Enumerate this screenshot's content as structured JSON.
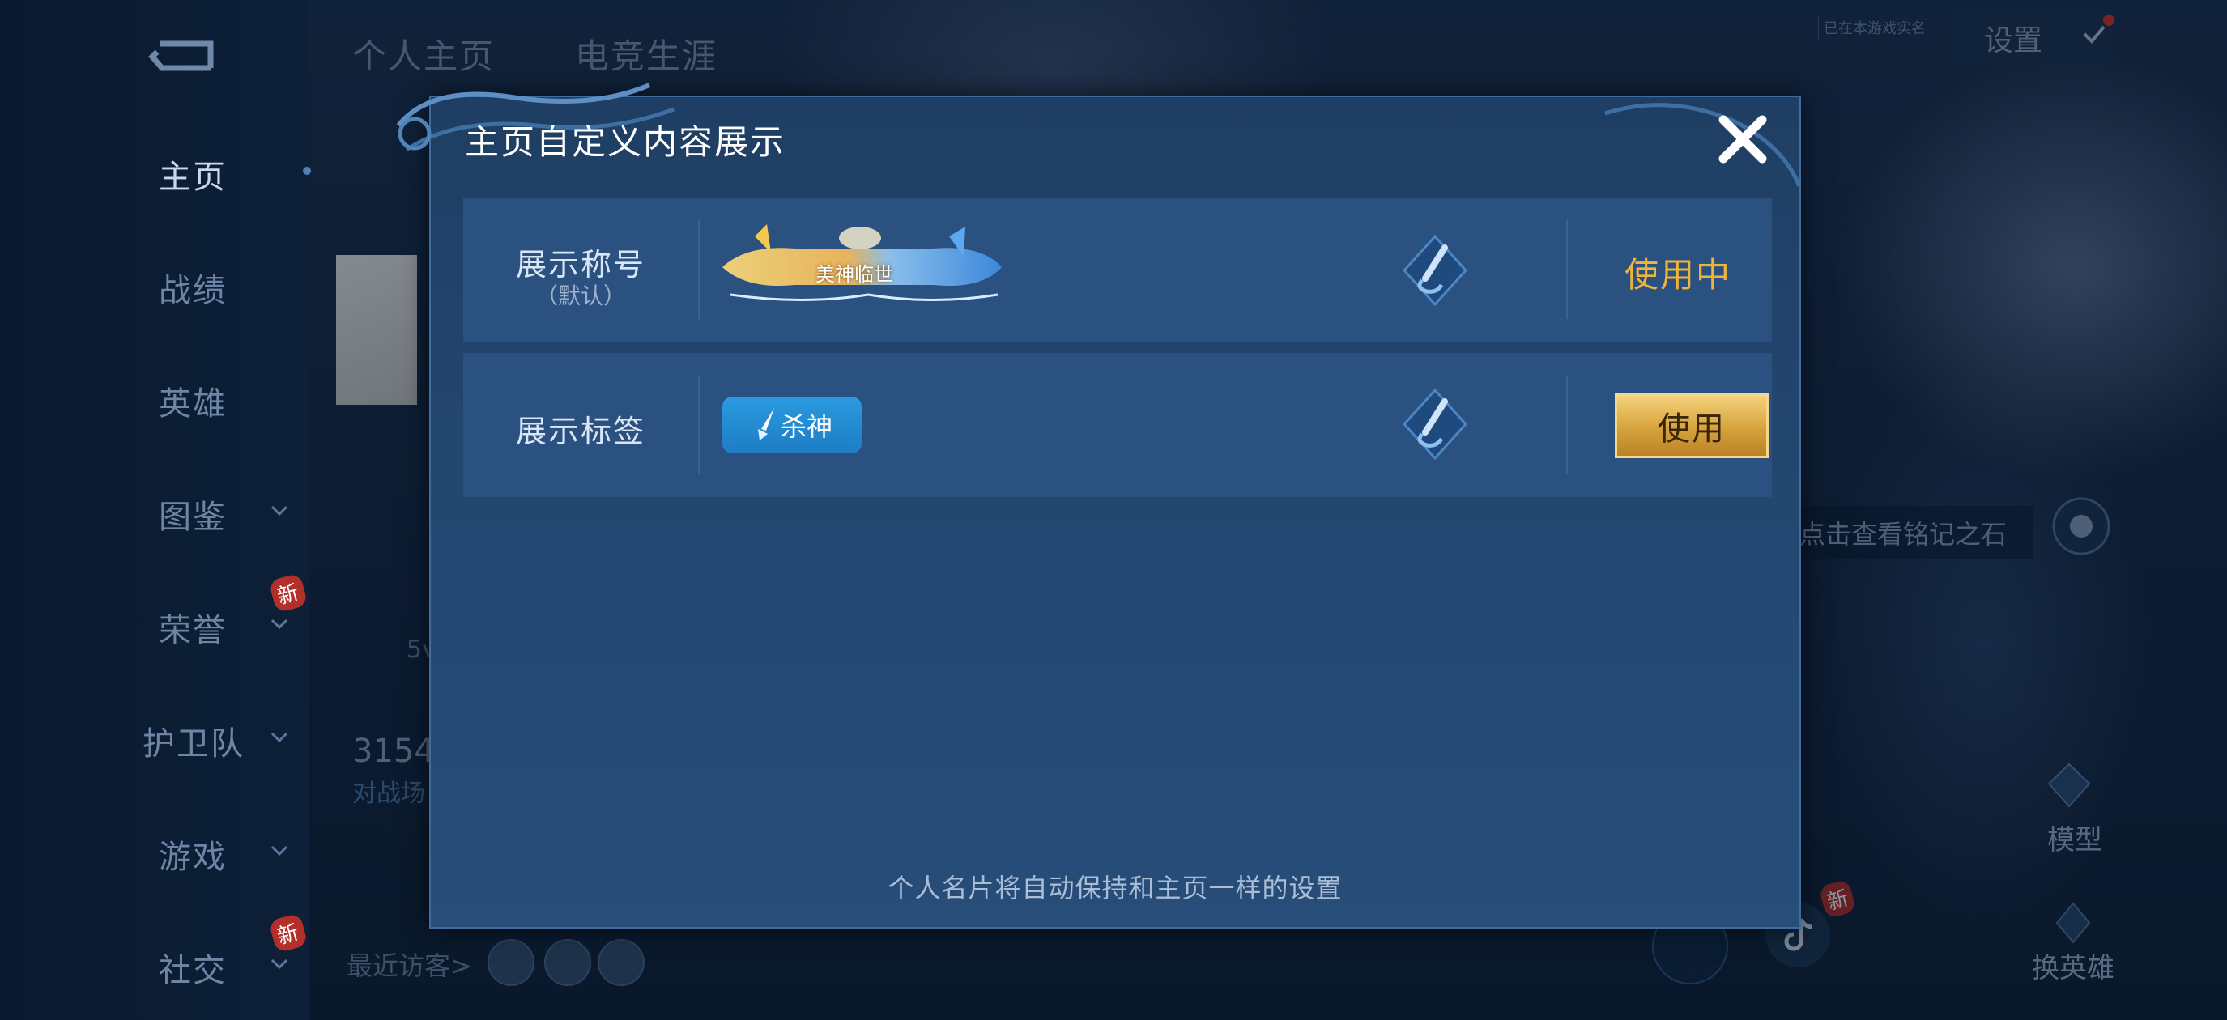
{
  "background": {
    "tabs": [
      "个人主页",
      "电竞生涯"
    ],
    "settings_label": "设置",
    "small_tag": "已在本游戏实名",
    "bg_number": "3154",
    "bg_sub": "对战场",
    "bg_5v": "5v",
    "right_hint": "点击查看铭记之石",
    "model_label": "模型",
    "swap_label": "换英雄",
    "visitors_label": "最近访客>"
  },
  "sidebar": {
    "items": [
      {
        "label": "主页",
        "active": true,
        "chevron": false
      },
      {
        "label": "战绩",
        "active": false,
        "chevron": false
      },
      {
        "label": "英雄",
        "active": false,
        "chevron": false
      },
      {
        "label": "图鉴",
        "active": false,
        "chevron": true
      },
      {
        "label": "荣誉",
        "active": false,
        "chevron": true,
        "badge": "新"
      },
      {
        "label": "护卫队",
        "active": false,
        "chevron": true
      },
      {
        "label": "游戏",
        "active": false,
        "chevron": true
      },
      {
        "label": "社交",
        "active": false,
        "chevron": true,
        "badge": "新"
      }
    ]
  },
  "modal": {
    "title": "主页自定义内容展示",
    "rows": [
      {
        "label": "展示称号",
        "sublabel": "（默认）",
        "badge_text": "美神临世",
        "status": "使用中"
      },
      {
        "label": "展示标签",
        "tag_text": "杀神",
        "action": "使用"
      }
    ],
    "footer": "个人名片将自动保持和主页一样的设置"
  },
  "badges": {
    "new": "新"
  },
  "colors": {
    "accent_gold": "#f0b43a",
    "tag_blue": "#2a9ae0",
    "modal_bg": "#23466f"
  }
}
